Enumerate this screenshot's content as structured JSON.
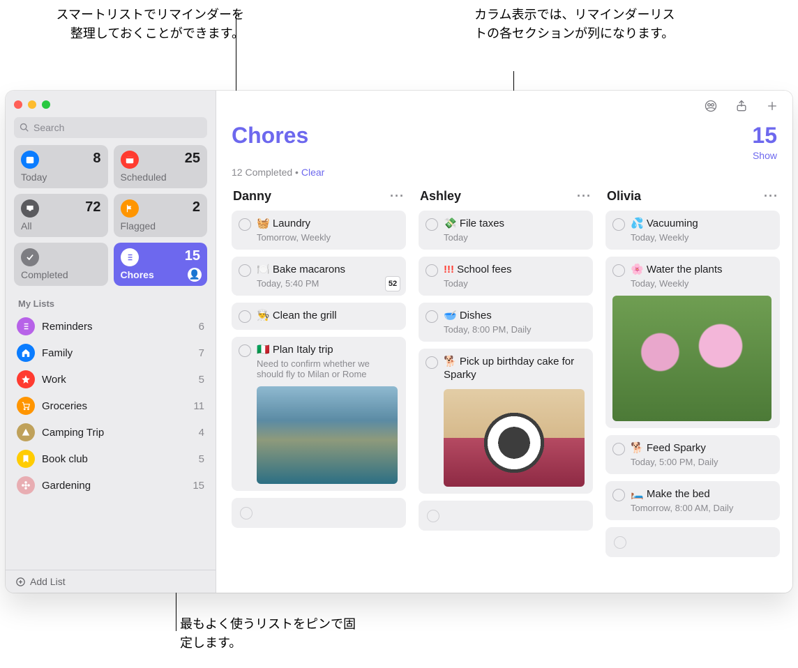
{
  "callouts": {
    "top_left": "スマートリストでリマインダーを整理しておくことができます。",
    "top_right": "カラム表示では、リマインダーリストの各セクションが列になります。",
    "bottom": "最もよく使うリストをピンで固定します。"
  },
  "search": {
    "placeholder": "Search"
  },
  "smart": {
    "today": {
      "label": "Today",
      "count": 8,
      "color": "#0a7cff"
    },
    "scheduled": {
      "label": "Scheduled",
      "count": 25,
      "color": "#ff3b30"
    },
    "all": {
      "label": "All",
      "count": 72,
      "color": "#5a5a5e"
    },
    "flagged": {
      "label": "Flagged",
      "count": 2,
      "color": "#ff9500"
    },
    "completed": {
      "label": "Completed",
      "count": "",
      "color": "#7d7d82"
    },
    "chores": {
      "label": "Chores",
      "count": 15,
      "color": "#6d68ee"
    }
  },
  "mylists_header": "My Lists",
  "mylists": [
    {
      "name": "Reminders",
      "count": 6,
      "color": "#b762e8",
      "glyph": "list"
    },
    {
      "name": "Family",
      "count": 7,
      "color": "#0a7cff",
      "glyph": "home"
    },
    {
      "name": "Work",
      "count": 5,
      "color": "#ff3b30",
      "glyph": "star"
    },
    {
      "name": "Groceries",
      "count": 11,
      "color": "#ff9500",
      "glyph": "cart"
    },
    {
      "name": "Camping Trip",
      "count": 4,
      "color": "#bfa15a",
      "glyph": "tent"
    },
    {
      "name": "Book club",
      "count": 5,
      "color": "#ffcc00",
      "glyph": "bookmark"
    },
    {
      "name": "Gardening",
      "count": 15,
      "color": "#e8adb2",
      "glyph": "flower"
    }
  ],
  "add_list_label": "Add List",
  "header": {
    "title": "Chores",
    "count": 15,
    "completed_text": "12 Completed",
    "separator": "  •  ",
    "clear": "Clear",
    "show": "Show"
  },
  "columns": [
    {
      "name": "Danny",
      "items": [
        {
          "emoji": "🧺",
          "title": "Laundry",
          "meta": "Tomorrow, Weekly"
        },
        {
          "emoji": "🍽️",
          "title": "Bake macarons",
          "meta": "Today, 5:40 PM",
          "cal": "52"
        },
        {
          "emoji": "👨‍🍳",
          "title": "Clean the grill"
        },
        {
          "emoji": "🇮🇹",
          "title": "Plan Italy trip",
          "note": "Need to confirm whether we should fly to Milan or Rome",
          "image": "italy"
        }
      ],
      "trailing_empty": true
    },
    {
      "name": "Ashley",
      "items": [
        {
          "emoji": "💸",
          "title": "File taxes",
          "meta": "Today"
        },
        {
          "emoji_text": "!!!",
          "title": "School fees",
          "meta": "Today"
        },
        {
          "emoji": "🥣",
          "title": "Dishes",
          "meta": "Today, 8:00 PM, Daily"
        },
        {
          "emoji": "🐕",
          "title": "Pick up birthday cake for Sparky",
          "image": "dog"
        }
      ],
      "trailing_empty": true
    },
    {
      "name": "Olivia",
      "items": [
        {
          "emoji": "💦",
          "title": "Vacuuming",
          "meta": "Today, Weekly"
        },
        {
          "emoji": "🌸",
          "title": "Water the plants",
          "meta": "Today, Weekly",
          "image": "flowers",
          "image_big": true
        },
        {
          "emoji": "🐕",
          "title": "Feed Sparky",
          "meta": "Today, 5:00 PM, Daily"
        },
        {
          "emoji": "🛏️",
          "title": "Make the bed",
          "meta": "Tomorrow, 8:00 AM, Daily"
        }
      ],
      "trailing_empty": true
    }
  ]
}
